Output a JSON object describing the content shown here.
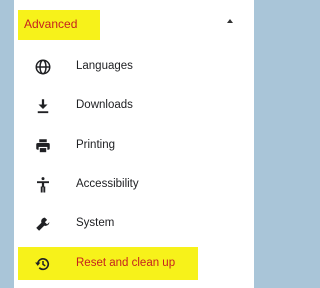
{
  "section": {
    "title": "Advanced",
    "expanded": true
  },
  "menu": {
    "items": [
      {
        "label": "Languages",
        "icon": "globe-icon"
      },
      {
        "label": "Downloads",
        "icon": "download-icon"
      },
      {
        "label": "Printing",
        "icon": "printer-icon"
      },
      {
        "label": "Accessibility",
        "icon": "accessibility-icon"
      },
      {
        "label": "System",
        "icon": "wrench-icon"
      },
      {
        "label": "Reset and clean up",
        "icon": "restore-icon",
        "highlighted": true
      }
    ]
  },
  "colors": {
    "highlight": "#f7f21a",
    "accent_text": "#c5221f",
    "icon": "#202124",
    "background_strip": "#a9c5d8"
  }
}
